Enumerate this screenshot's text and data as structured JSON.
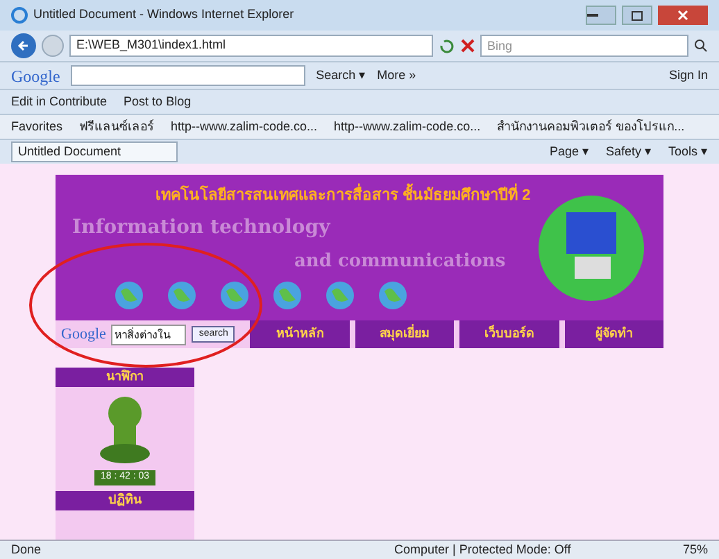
{
  "window": {
    "title": "Untitled Document - Windows Internet Explorer"
  },
  "address_bar": {
    "url": "E:\\WEB_M301\\index1.html",
    "search_placeholder": "Bing"
  },
  "google_toolbar": {
    "logo": "Google",
    "search_button": "Search ▾",
    "more": "More »",
    "sign_in": "Sign In"
  },
  "contribute_bar": {
    "items": [
      "Edit in Contribute",
      "Post to Blog"
    ]
  },
  "favorites_bar": {
    "label": "Favorites",
    "items": [
      "ฟรีแลนซ์เลอร์",
      "http--www.zalim-code.co...",
      "http--www.zalim-code.co...",
      "สำนักงานคอมพิวเตอร์ ของโปรแก..."
    ]
  },
  "tab": {
    "title": "Untitled Document"
  },
  "command_bar": [
    "Page ▾",
    "Safety ▾",
    "Tools ▾"
  ],
  "page": {
    "banner_title": "เทคโนโลยีสารสนเทศและการสื่อสาร ชั้นมัธยมศึกษาปีที่ 2",
    "banner_subtitle_1": "Information technology",
    "banner_subtitle_2": "and communications",
    "google_logo": "Google",
    "search_value": "หาสิ่งต่างใน",
    "search_button": "search",
    "nav": [
      {
        "label": "หน้าหลัก"
      },
      {
        "label": "สมุดเยี่ยม"
      },
      {
        "label": "เว็บบอร์ด"
      },
      {
        "label": "ผู้จัดทำ"
      }
    ],
    "sidebar": [
      {
        "kind": "clock",
        "title": "นาฬิกา",
        "time": "18 : 42 : 03"
      },
      {
        "kind": "calendar",
        "title": "ปฏิทิน"
      }
    ]
  },
  "status_bar": {
    "text": "Done",
    "zone": "Computer | Protected Mode: Off",
    "zoom": "75%"
  }
}
